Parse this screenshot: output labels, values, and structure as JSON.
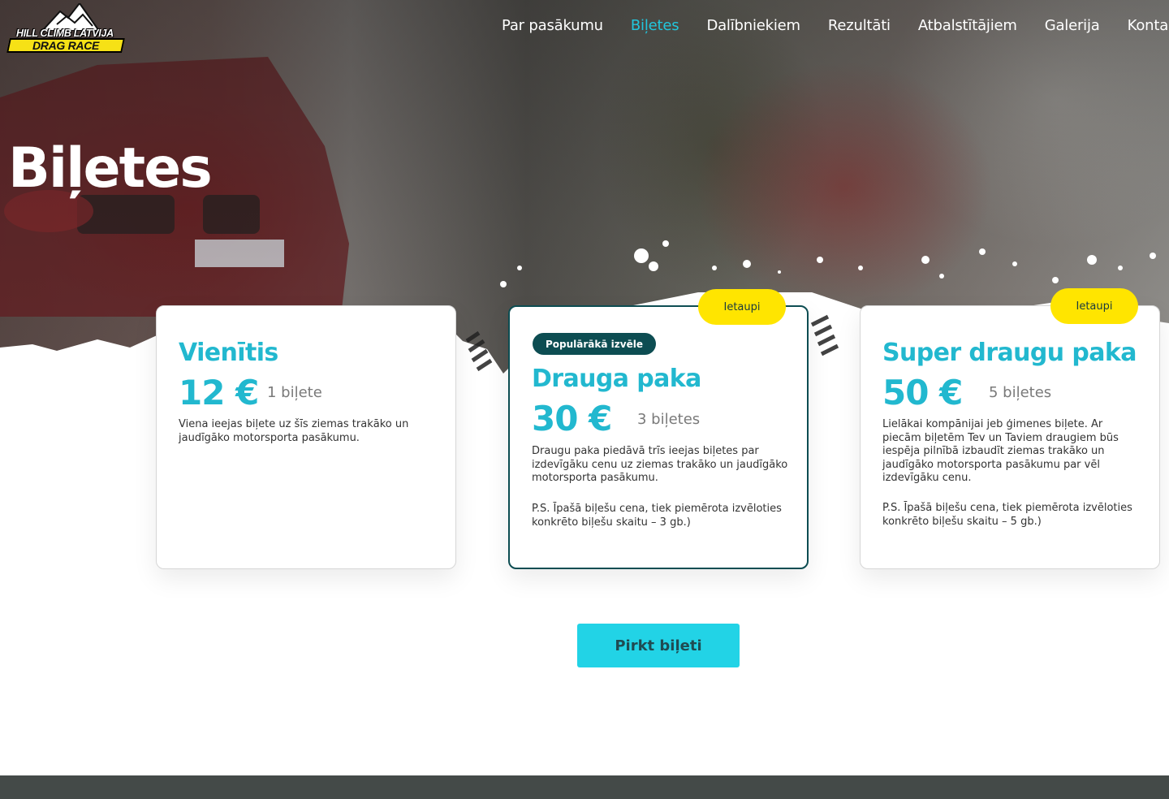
{
  "logo": {
    "line1": "HILL CLIMB LATVIJA",
    "line2": "DRAG RACE"
  },
  "nav": {
    "items": [
      {
        "label": "Par pasākumu"
      },
      {
        "label": "Biļetes",
        "active": true
      },
      {
        "label": "Dalībniekiem"
      },
      {
        "label": "Rezultāti"
      },
      {
        "label": "Atbalstītājiem"
      },
      {
        "label": "Galerija"
      },
      {
        "label": "Kontakti"
      }
    ]
  },
  "hero": {
    "title": "Biļetes"
  },
  "cards": [
    {
      "title": "Vienītis",
      "price": "12 €",
      "quantity": "1 biļete",
      "description": "Viena ieejas biļete uz šīs ziemas trakāko un jaudīgāko motorsporta pasākumu."
    },
    {
      "badge_save": "Ietaupi",
      "badge_popular": "Populārākā izvēle",
      "title": "Drauga paka",
      "price": "30 €",
      "quantity": "3 biļetes",
      "description": "Draugu paka piedāvā trīs ieejas biļetes par izdevīgāku cenu uz ziemas trakāko un jaudīgāko motorsporta pasākumu.",
      "note": "P.S. Īpašā biļešu cena, tiek piemērota izvēloties konkrēto biļešu skaitu – 3 gb.)"
    },
    {
      "badge_save": "Ietaupi",
      "title": "Super draugu paka",
      "price": "50 €",
      "quantity": "5 biļetes",
      "description": "Lielākai kompānijai jeb ģimenes biļete. Ar piecām biļetēm Tev un Taviem draugiem būs iespēja pilnībā izbaudīt ziemas trakāko un jaudīgāko motorsporta pasākumu par vēl izdevīgāku cenu.",
      "note": "P.S. Īpašā biļešu cena, tiek piemērota izvēloties konkrēto biļešu skaitu – 5 gb.)"
    }
  ],
  "cta": {
    "buy_label": "Pirkt biļeti"
  },
  "colors": {
    "accent": "#22b8cf",
    "button": "#22d3e6",
    "dark_teal": "#0d4d52",
    "save_badge": "#ffe500",
    "footer": "#444a48"
  }
}
